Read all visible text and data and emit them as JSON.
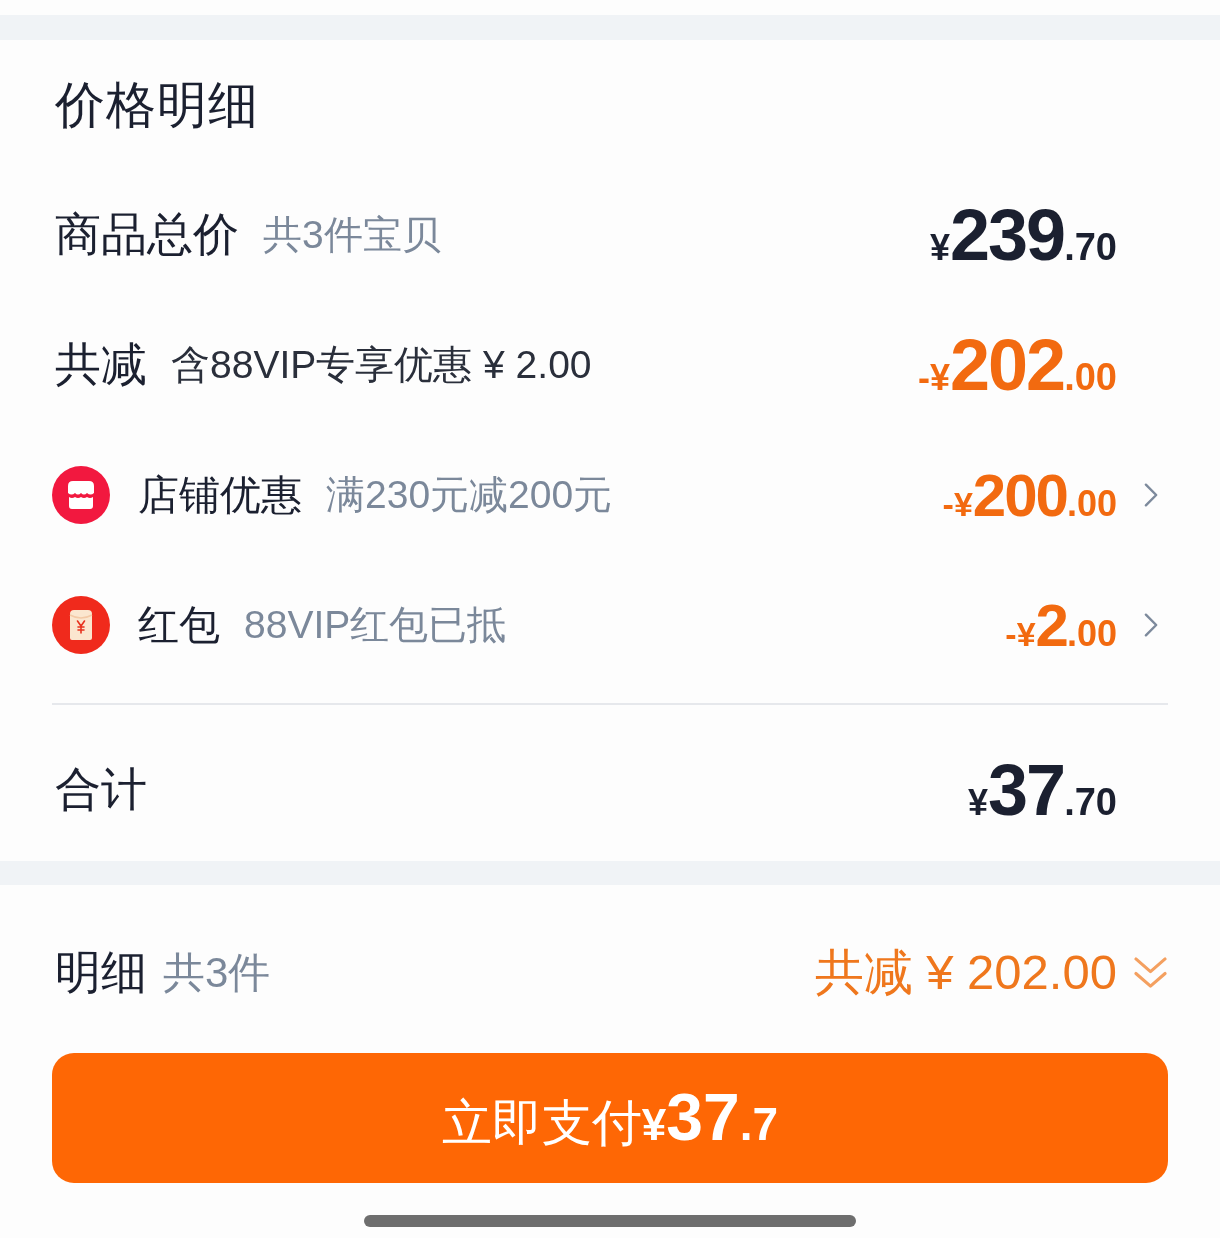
{
  "price_details": {
    "title": "价格明细",
    "rows": [
      {
        "kind": "subtotal",
        "label": "商品总价",
        "note": "共3件宝贝",
        "amount": {
          "prefix": "¥",
          "integer": "239",
          "decimal": ".70"
        }
      },
      {
        "kind": "discount",
        "label": "共减",
        "note": "含88VIP专享优惠 ¥ 2.00",
        "amount": {
          "prefix": "-¥",
          "integer": "202",
          "decimal": ".00"
        }
      },
      {
        "kind": "shop",
        "label": "店铺优惠",
        "note": "满230元减200元",
        "amount": {
          "prefix": "-¥",
          "integer": "200",
          "decimal": ".00"
        }
      },
      {
        "kind": "packet",
        "label": "红包",
        "note": "88VIP红包已抵",
        "amount": {
          "prefix": "-¥",
          "integer": "2",
          "decimal": ".00"
        }
      },
      {
        "kind": "total",
        "label": "合计",
        "amount": {
          "prefix": "¥",
          "integer": "37",
          "decimal": ".70"
        }
      }
    ]
  },
  "summary_bar": {
    "label": "明细",
    "note": "共3件",
    "savings": "共减 ¥ 202.00",
    "expanded": false
  },
  "pay_button": {
    "label": "立即支付",
    "prefix": "¥",
    "integer": "37",
    "decimal": ".7"
  }
}
